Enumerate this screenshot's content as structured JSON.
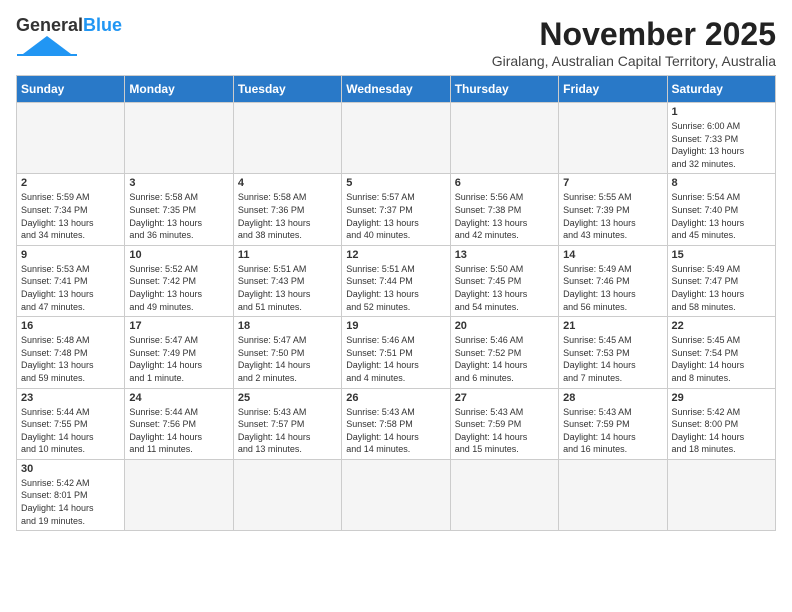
{
  "header": {
    "logo_general": "General",
    "logo_blue": "Blue",
    "month": "November 2025",
    "location": "Giralang, Australian Capital Territory, Australia"
  },
  "days_of_week": [
    "Sunday",
    "Monday",
    "Tuesday",
    "Wednesday",
    "Thursday",
    "Friday",
    "Saturday"
  ],
  "weeks": [
    [
      {
        "num": "",
        "info": ""
      },
      {
        "num": "",
        "info": ""
      },
      {
        "num": "",
        "info": ""
      },
      {
        "num": "",
        "info": ""
      },
      {
        "num": "",
        "info": ""
      },
      {
        "num": "",
        "info": ""
      },
      {
        "num": "1",
        "info": "Sunrise: 6:00 AM\nSunset: 7:33 PM\nDaylight: 13 hours\nand 32 minutes."
      }
    ],
    [
      {
        "num": "2",
        "info": "Sunrise: 5:59 AM\nSunset: 7:34 PM\nDaylight: 13 hours\nand 34 minutes."
      },
      {
        "num": "3",
        "info": "Sunrise: 5:58 AM\nSunset: 7:35 PM\nDaylight: 13 hours\nand 36 minutes."
      },
      {
        "num": "4",
        "info": "Sunrise: 5:58 AM\nSunset: 7:36 PM\nDaylight: 13 hours\nand 38 minutes."
      },
      {
        "num": "5",
        "info": "Sunrise: 5:57 AM\nSunset: 7:37 PM\nDaylight: 13 hours\nand 40 minutes."
      },
      {
        "num": "6",
        "info": "Sunrise: 5:56 AM\nSunset: 7:38 PM\nDaylight: 13 hours\nand 42 minutes."
      },
      {
        "num": "7",
        "info": "Sunrise: 5:55 AM\nSunset: 7:39 PM\nDaylight: 13 hours\nand 43 minutes."
      },
      {
        "num": "8",
        "info": "Sunrise: 5:54 AM\nSunset: 7:40 PM\nDaylight: 13 hours\nand 45 minutes."
      }
    ],
    [
      {
        "num": "9",
        "info": "Sunrise: 5:53 AM\nSunset: 7:41 PM\nDaylight: 13 hours\nand 47 minutes."
      },
      {
        "num": "10",
        "info": "Sunrise: 5:52 AM\nSunset: 7:42 PM\nDaylight: 13 hours\nand 49 minutes."
      },
      {
        "num": "11",
        "info": "Sunrise: 5:51 AM\nSunset: 7:43 PM\nDaylight: 13 hours\nand 51 minutes."
      },
      {
        "num": "12",
        "info": "Sunrise: 5:51 AM\nSunset: 7:44 PM\nDaylight: 13 hours\nand 52 minutes."
      },
      {
        "num": "13",
        "info": "Sunrise: 5:50 AM\nSunset: 7:45 PM\nDaylight: 13 hours\nand 54 minutes."
      },
      {
        "num": "14",
        "info": "Sunrise: 5:49 AM\nSunset: 7:46 PM\nDaylight: 13 hours\nand 56 minutes."
      },
      {
        "num": "15",
        "info": "Sunrise: 5:49 AM\nSunset: 7:47 PM\nDaylight: 13 hours\nand 58 minutes."
      }
    ],
    [
      {
        "num": "16",
        "info": "Sunrise: 5:48 AM\nSunset: 7:48 PM\nDaylight: 13 hours\nand 59 minutes."
      },
      {
        "num": "17",
        "info": "Sunrise: 5:47 AM\nSunset: 7:49 PM\nDaylight: 14 hours\nand 1 minute."
      },
      {
        "num": "18",
        "info": "Sunrise: 5:47 AM\nSunset: 7:50 PM\nDaylight: 14 hours\nand 2 minutes."
      },
      {
        "num": "19",
        "info": "Sunrise: 5:46 AM\nSunset: 7:51 PM\nDaylight: 14 hours\nand 4 minutes."
      },
      {
        "num": "20",
        "info": "Sunrise: 5:46 AM\nSunset: 7:52 PM\nDaylight: 14 hours\nand 6 minutes."
      },
      {
        "num": "21",
        "info": "Sunrise: 5:45 AM\nSunset: 7:53 PM\nDaylight: 14 hours\nand 7 minutes."
      },
      {
        "num": "22",
        "info": "Sunrise: 5:45 AM\nSunset: 7:54 PM\nDaylight: 14 hours\nand 8 minutes."
      }
    ],
    [
      {
        "num": "23",
        "info": "Sunrise: 5:44 AM\nSunset: 7:55 PM\nDaylight: 14 hours\nand 10 minutes."
      },
      {
        "num": "24",
        "info": "Sunrise: 5:44 AM\nSunset: 7:56 PM\nDaylight: 14 hours\nand 11 minutes."
      },
      {
        "num": "25",
        "info": "Sunrise: 5:43 AM\nSunset: 7:57 PM\nDaylight: 14 hours\nand 13 minutes."
      },
      {
        "num": "26",
        "info": "Sunrise: 5:43 AM\nSunset: 7:58 PM\nDaylight: 14 hours\nand 14 minutes."
      },
      {
        "num": "27",
        "info": "Sunrise: 5:43 AM\nSunset: 7:59 PM\nDaylight: 14 hours\nand 15 minutes."
      },
      {
        "num": "28",
        "info": "Sunrise: 5:43 AM\nSunset: 7:59 PM\nDaylight: 14 hours\nand 16 minutes."
      },
      {
        "num": "29",
        "info": "Sunrise: 5:42 AM\nSunset: 8:00 PM\nDaylight: 14 hours\nand 18 minutes."
      }
    ],
    [
      {
        "num": "30",
        "info": "Sunrise: 5:42 AM\nSunset: 8:01 PM\nDaylight: 14 hours\nand 19 minutes."
      },
      {
        "num": "",
        "info": ""
      },
      {
        "num": "",
        "info": ""
      },
      {
        "num": "",
        "info": ""
      },
      {
        "num": "",
        "info": ""
      },
      {
        "num": "",
        "info": ""
      },
      {
        "num": "",
        "info": ""
      }
    ]
  ]
}
